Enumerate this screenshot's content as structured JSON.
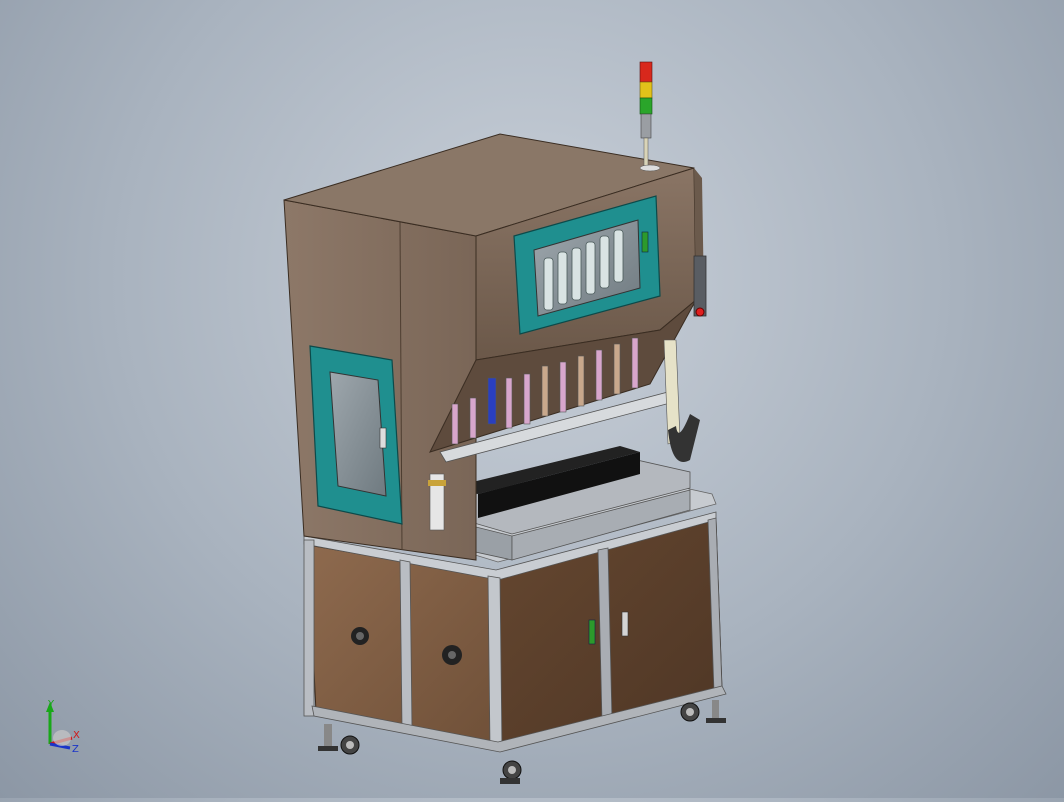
{
  "viewport": {
    "background_top": "#c9d0d9",
    "background_bottom": "#8c97a5"
  },
  "model": {
    "cabinet_color": "#7a5b44",
    "hood_color": "#7a6a5c",
    "window_frame_color": "#1f8f8f",
    "frame_color": "#b8bcc2",
    "signal_tower": [
      "#d8281c",
      "#e2c21a",
      "#2aa52a"
    ]
  },
  "triad": {
    "x_label": "X",
    "y_label": "Y",
    "z_label": "Z",
    "x_color": "#d01818",
    "y_color": "#18a818",
    "z_color": "#1a34c8"
  }
}
